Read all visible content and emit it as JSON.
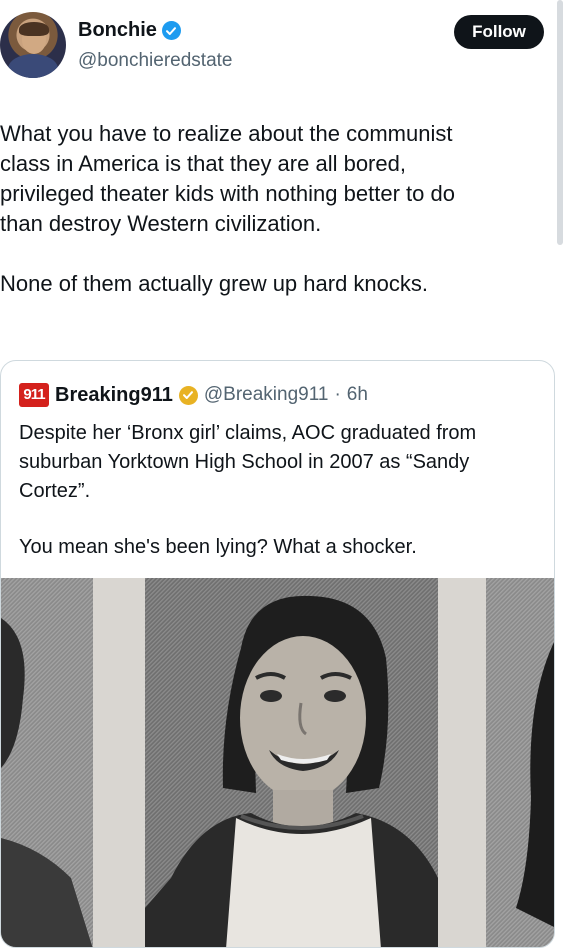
{
  "author": {
    "display_name": "Bonchie",
    "handle": "@bonchieredstate",
    "follow_label": "Follow",
    "verified_color": "#1d9bf0"
  },
  "tweet": {
    "paragraph_1": "What you have to realize about the communist\nclass in America is that they are all bored,\nprivileged theater kids with nothing better to do\nthan destroy Western civilization.",
    "paragraph_2": "None of them actually grew up hard knocks."
  },
  "quoted": {
    "logo_text": "911",
    "display_name": "Breaking911",
    "handle": "@Breaking911",
    "separator": "·",
    "time": "6h",
    "badge_color": "#e8b223",
    "paragraph_1": "Despite her ‘Bronx girl’ claims, AOC graduated from\nsuburban Yorktown High School in 2007 as “Sandy\nCortez”.",
    "paragraph_2": "You mean she's been lying? What a shocker.",
    "media_description": "black-and-white yearbook photo"
  }
}
